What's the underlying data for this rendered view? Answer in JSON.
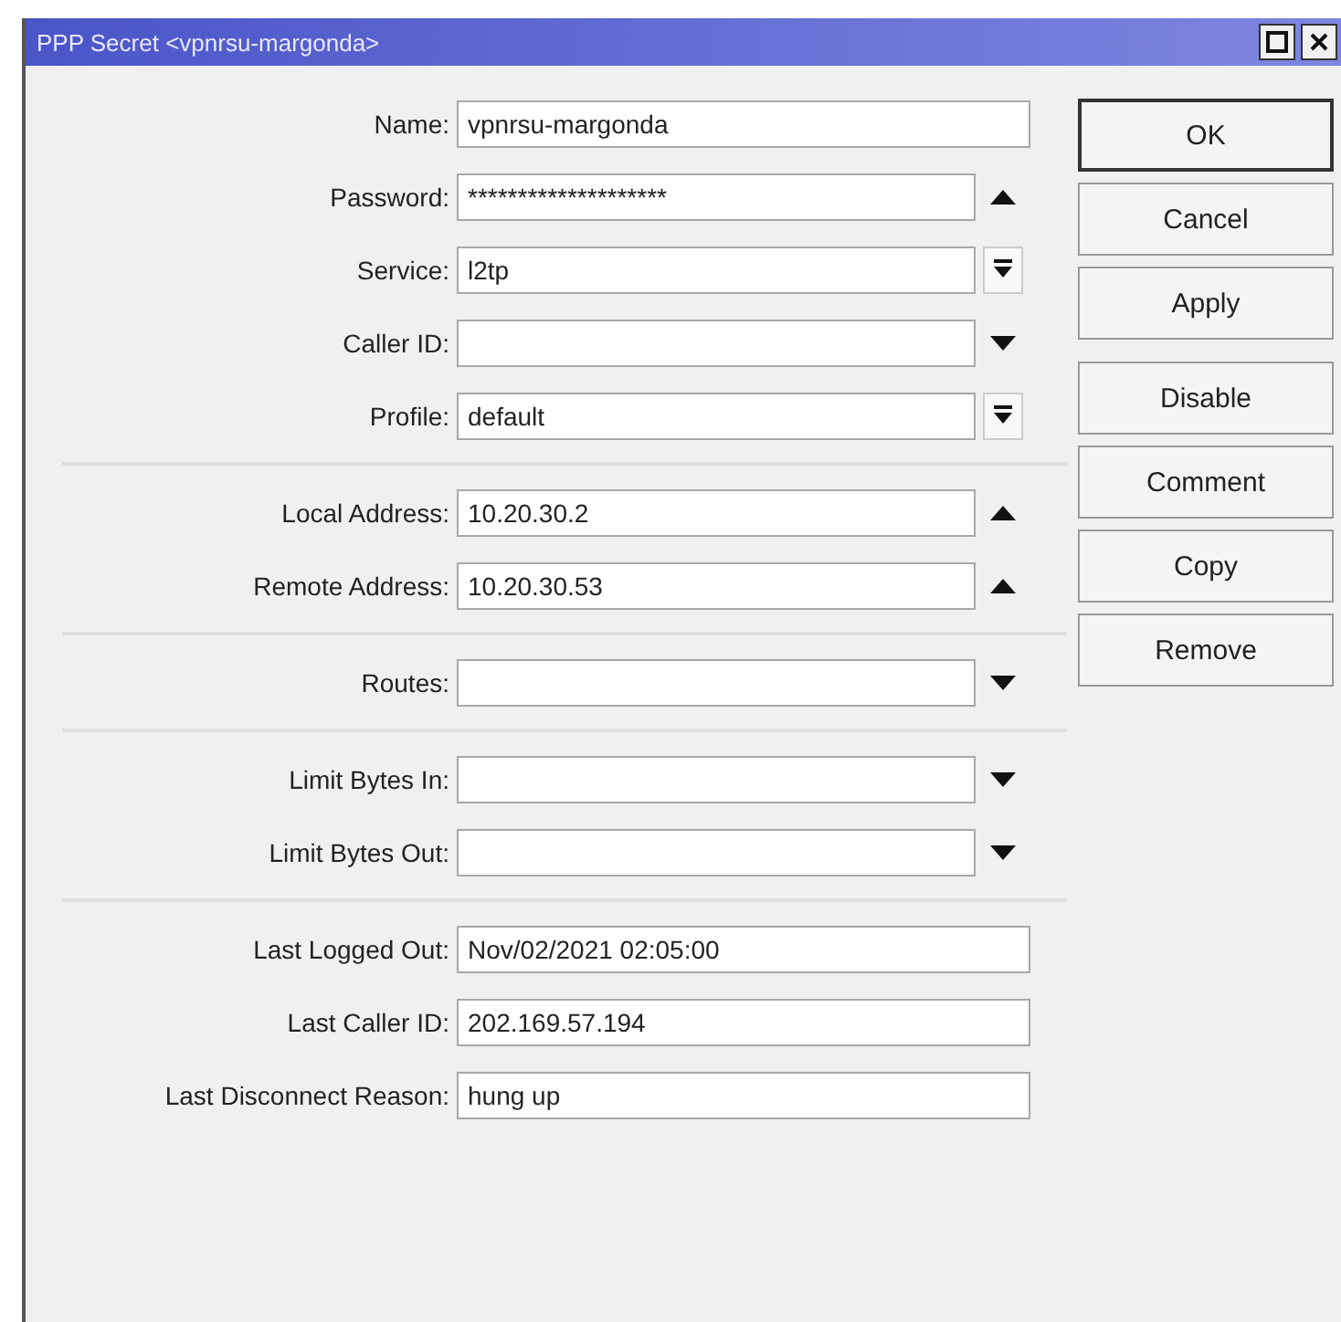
{
  "window": {
    "title": "PPP Secret <vpnrsu-margonda>"
  },
  "groups": [
    [
      {
        "label": "Name:",
        "value": "vpnrsu-margonda",
        "kind": "plain"
      },
      {
        "label": "Password:",
        "value": "********************",
        "kind": "collapse"
      },
      {
        "label": "Service:",
        "value": "l2tp",
        "kind": "combo"
      },
      {
        "label": "Caller ID:",
        "kind": "expand"
      },
      {
        "label": "Profile:",
        "value": "default",
        "kind": "combo"
      }
    ],
    [
      {
        "label": "Local Address:",
        "value": "10.20.30.2",
        "kind": "collapse"
      },
      {
        "label": "Remote Address:",
        "value": "10.20.30.53",
        "kind": "collapse"
      }
    ],
    [
      {
        "label": "Routes:",
        "kind": "expand"
      }
    ],
    [
      {
        "label": "Limit Bytes In:",
        "kind": "expand"
      },
      {
        "label": "Limit Bytes Out:",
        "kind": "expand"
      }
    ],
    [
      {
        "label": "Last Logged Out:",
        "value": "Nov/02/2021 02:05:00",
        "kind": "plain"
      },
      {
        "label": "Last Caller ID:",
        "value": "202.169.57.194",
        "kind": "plain"
      },
      {
        "label": "Last Disconnect Reason:",
        "value": "hung up",
        "kind": "plain"
      }
    ]
  ],
  "buttons": [
    {
      "label": "OK",
      "default": true
    },
    {
      "label": "Cancel",
      "default": false
    },
    {
      "label": "Apply",
      "default": false
    },
    {
      "label": "Disable",
      "default": false
    },
    {
      "label": "Comment",
      "default": false
    },
    {
      "label": "Copy",
      "default": false
    },
    {
      "label": "Remove",
      "default": false
    }
  ]
}
